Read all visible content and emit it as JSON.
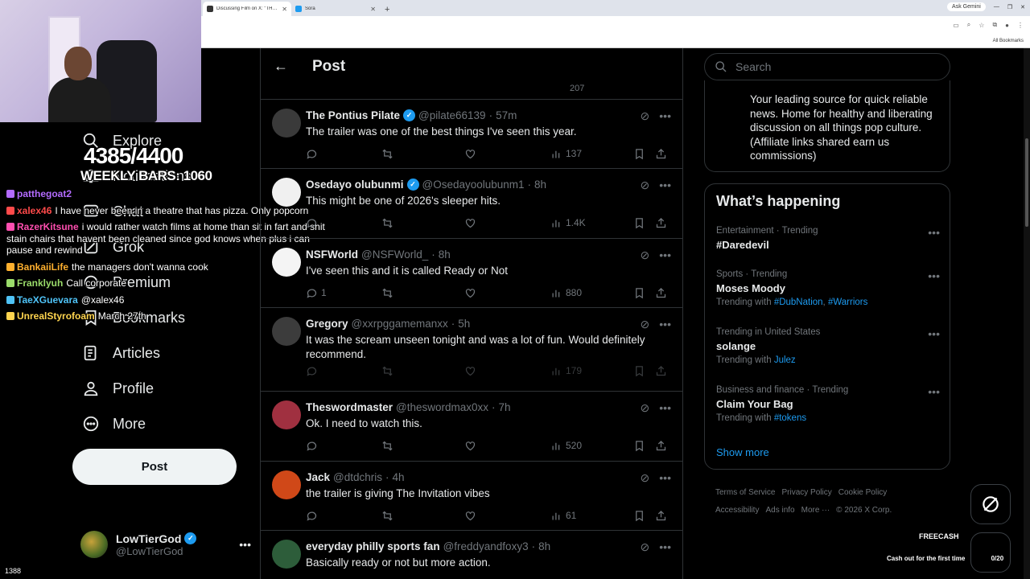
{
  "browser": {
    "tabs": [
      {
        "title": "Discussing Film on X: \"THEY W",
        "active": true
      },
      {
        "title": "Sora",
        "active": false
      }
    ],
    "ask_gemini": "Ask Gemini",
    "all_bookmarks": "All Bookmarks"
  },
  "overlay": {
    "goal": "4385/4400",
    "weekly": "WEEKLY BARS: 1060",
    "viewers": "1388",
    "chat": [
      {
        "user": "patthegoat2",
        "color": "#b36bff",
        "text": ""
      },
      {
        "user": "xalex46",
        "color": "#ff4a4a",
        "text": "I have never been in a theatre that has pizza. Only popcorn"
      },
      {
        "user": "RazerKitsune",
        "color": "#ff4fb0",
        "text": "i would rather watch films at home than sit in fart and shit stain chairs that havent been cleaned since god knows when plus i can pause and rewind"
      },
      {
        "user": "BankaiiLife",
        "color": "#ffb02e",
        "text": "the managers don't wanna cook"
      },
      {
        "user": "Franklyuh",
        "color": "#9bdc6b",
        "text": "Call corporate"
      },
      {
        "user": "TaeXGuevara",
        "color": "#4fc3f7",
        "text": "@xalex46"
      },
      {
        "user": "UnrealStyrofoam",
        "color": "#ffd54f",
        "text": "March 27th"
      }
    ]
  },
  "nav": {
    "items": [
      {
        "label": "Explore",
        "icon": "search-icon"
      },
      {
        "label": "Notifications",
        "icon": "bell-icon"
      },
      {
        "label": "Chat",
        "icon": "chat-icon"
      },
      {
        "label": "Grok",
        "icon": "grok-icon"
      },
      {
        "label": "Premium",
        "icon": "premium-icon"
      },
      {
        "label": "Bookmarks",
        "icon": "bookmark-icon"
      },
      {
        "label": "Articles",
        "icon": "articles-icon"
      },
      {
        "label": "Profile",
        "icon": "profile-icon"
      },
      {
        "label": "More",
        "icon": "more-icon"
      }
    ],
    "post_label": "Post",
    "account": {
      "name": "LowTierGod",
      "handle": "@LowTierGod"
    }
  },
  "main": {
    "title": "Post",
    "prev_views": "207",
    "tweets": [
      {
        "name": "The Pontius Pilate",
        "verified": true,
        "handle": "@pilate66139",
        "time": "57m",
        "text": "The trailer was one of the best things I've seen this year.",
        "replies": "",
        "views": "137"
      },
      {
        "name": "Osedayo olubunmi",
        "verified": true,
        "handle": "@Osedayoolubunm1",
        "time": "8h",
        "text": "This might be one of 2026's sleeper hits.",
        "replies": "",
        "views": "1.4K"
      },
      {
        "name": "NSFWorld",
        "verified": false,
        "handle": "@NSFWorld_",
        "time": "8h",
        "text": "I've seen this and it is called Ready or Not",
        "replies": "1",
        "views": "880"
      },
      {
        "name": "Gregory",
        "verified": false,
        "handle": "@xxrpggamemanxx",
        "time": "5h",
        "text": "It was the scream unseen tonight and was a lot of fun. Would definitely recommend.",
        "replies": "",
        "views": "179"
      },
      {
        "name": "Theswordmaster",
        "verified": false,
        "handle": "@theswordmax0xx",
        "time": "7h",
        "text": "Ok. I need to watch this.",
        "replies": "",
        "views": "520"
      },
      {
        "name": "Jack",
        "verified": false,
        "handle": "@dtdchris",
        "time": "4h",
        "text": "the trailer is giving The Invitation vibes",
        "replies": "",
        "views": "61"
      },
      {
        "name": "everyday philly sports fan",
        "verified": false,
        "handle": "@freddyandfoxy3",
        "time": "8h",
        "text": "Basically ready or not but more action.",
        "replies": "",
        "views": ""
      }
    ]
  },
  "right": {
    "search_placeholder": "Search",
    "bio": "Your leading source for quick reliable news. Home for healthy and liberating discussion on all things pop culture. (Affiliate links shared earn us commissions)",
    "happening_title": "What’s happening",
    "trends": [
      {
        "meta": "Entertainment · Trending",
        "title": "#Daredevil",
        "with_label": "",
        "tags": []
      },
      {
        "meta": "Sports · Trending",
        "title": "Moses Moody",
        "with_label": "Trending with",
        "tags": [
          "#DubNation",
          "#Warriors"
        ]
      },
      {
        "meta": "Trending in United States",
        "title": "solange",
        "with_label": "Trending with",
        "tags": [
          "Julez"
        ]
      },
      {
        "meta": "Business and finance · Trending",
        "title": "Claim Your Bag",
        "with_label": "Trending with",
        "tags": [
          "#tokens"
        ]
      }
    ],
    "show_more": "Show more",
    "footer": [
      "Terms of Service",
      "Privacy Policy",
      "Cookie Policy",
      "Accessibility",
      "Ads info",
      "More ···",
      "© 2026 X Corp."
    ],
    "freecash_logo": "FREECASH",
    "freecash_text": "Cash out for the first time",
    "freecash_count": "0/20"
  },
  "colors": {
    "accent": "#1d9bf0",
    "bg": "#000000",
    "border": "#2f3336",
    "muted": "#71767b"
  }
}
